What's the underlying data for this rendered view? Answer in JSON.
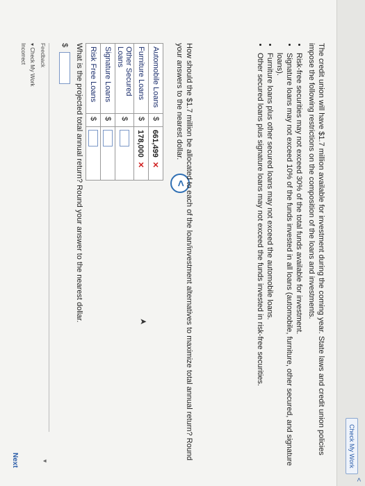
{
  "left_panel": {
    "check_label": "Check My Work"
  },
  "intro": "The credit union will have $1.7 million available for investment during the coming year. State laws and credit union policies impose the following restrictions on the composition of the loans and investments.",
  "bullets": [
    "Risk-free securities may not exceed 30% of the total funds available for investment.",
    "Signature loans may not exceed 10% of the funds invested in all loans (automobile, furniture, other secured, and signature loans).",
    "Furniture loans plus other secured loans may not exceed the automobile loans.",
    "Other secured loans plus signature loans may not exceed the funds invested in risk-free securities."
  ],
  "question1": "How should the $1.7 million be allocated to each of the loan/investment alternatives to maximize total annual return? Round your answers to the nearest dollar.",
  "table": {
    "rows": [
      {
        "label": "Automobile Loans",
        "currency": "$",
        "value": "661,499",
        "mark": "✕"
      },
      {
        "label": "Furniture Loans",
        "currency": "$",
        "value": "178,000",
        "mark": "✕"
      },
      {
        "label": "Other Secured Loans",
        "currency": "$",
        "value": "",
        "mark": ""
      },
      {
        "label": "Signature Loans",
        "currency": "$",
        "value": "",
        "mark": ""
      },
      {
        "label": "Risk Free Loans",
        "currency": "$",
        "value": "",
        "mark": ""
      }
    ]
  },
  "question2": "What is the projected total annual return? Round your answer to the nearest dollar.",
  "answer": {
    "currency": "$",
    "value": ""
  },
  "feedback": {
    "title": "Feedback",
    "check": "▾ Check My Work",
    "result": "Incorrect"
  },
  "nav": {
    "back": "<",
    "next": "Next",
    "chevron": "<"
  }
}
